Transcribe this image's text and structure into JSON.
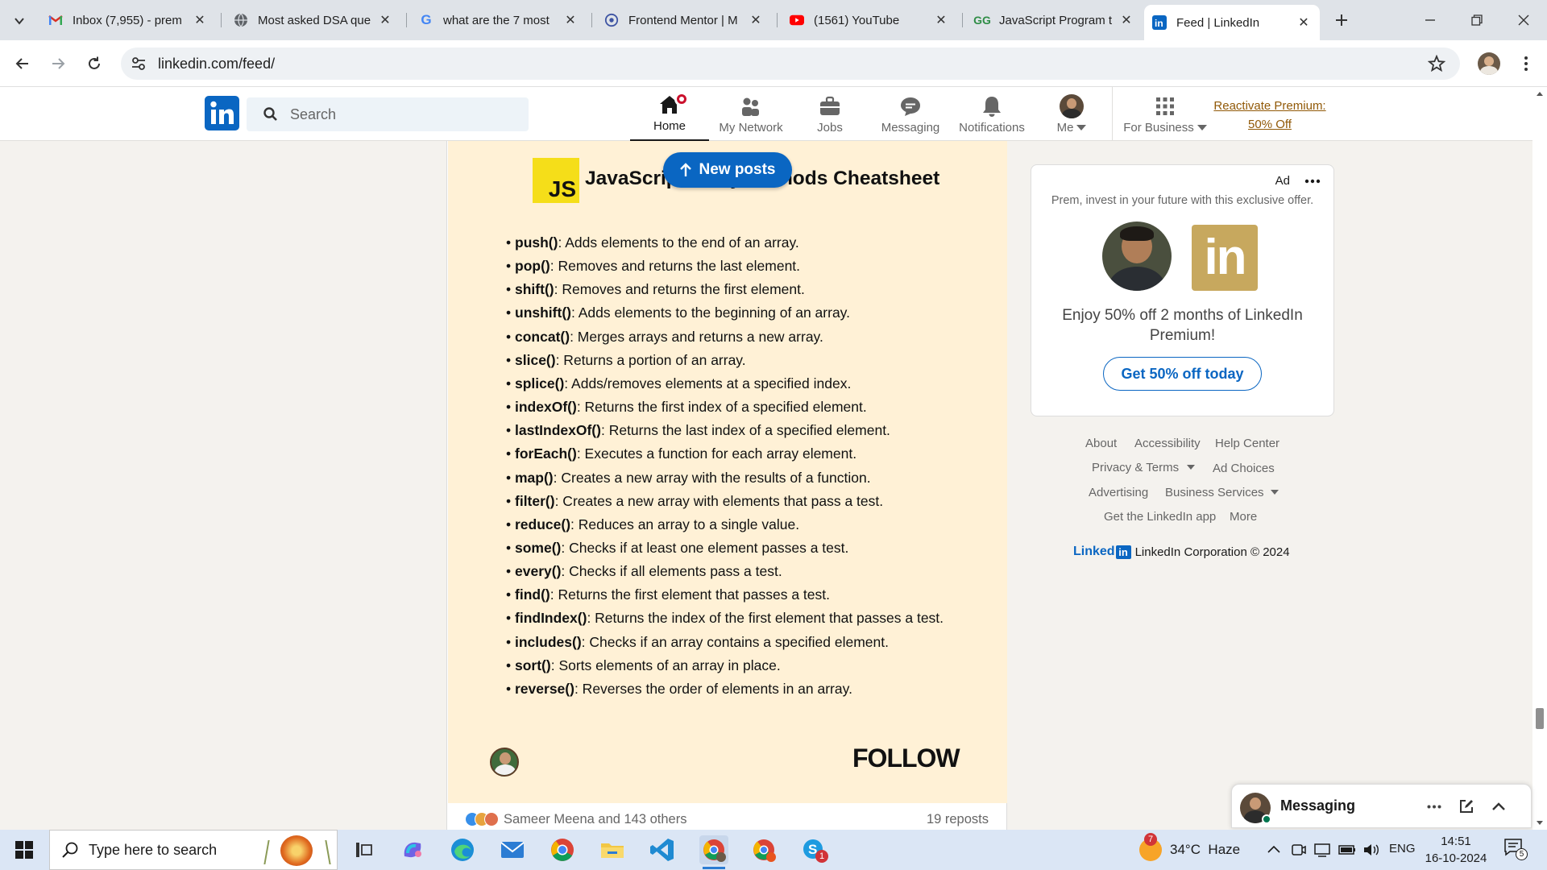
{
  "browser": {
    "tabs": [
      {
        "title": "Inbox (7,955) - prem"
      },
      {
        "title": "Most asked DSA que"
      },
      {
        "title": "what are the 7 most"
      },
      {
        "title": "Frontend Mentor | M"
      },
      {
        "title": "(1561) YouTube"
      },
      {
        "title": "JavaScript Program t"
      },
      {
        "title": "Feed | LinkedIn"
      }
    ],
    "url": "linkedin.com/feed/"
  },
  "linkedin": {
    "search_placeholder": "Search",
    "nav": {
      "home": "Home",
      "network": "My Network",
      "jobs": "Jobs",
      "messaging": "Messaging",
      "notifications": "Notifications",
      "me": "Me",
      "business": "For Business",
      "premium_line1": "Reactivate Premium:",
      "premium_line2": "50% Off"
    },
    "home_badge_color": "#cb112d"
  },
  "post": {
    "new_posts": "New posts",
    "sheet_badge": "JS",
    "sheet_title": "JavaScript Array Methods Cheatsheet",
    "methods": [
      {
        "name": "push()",
        "desc": ": Adds elements to the end of an array."
      },
      {
        "name": "pop()",
        "desc": ": Removes and returns the last element."
      },
      {
        "name": "shift()",
        "desc": ": Removes and returns the first element."
      },
      {
        "name": "unshift()",
        "desc": ": Adds elements to the beginning of an array."
      },
      {
        "name": "concat()",
        "desc": ": Merges arrays and returns a new array."
      },
      {
        "name": "slice()",
        "desc": ": Returns a portion of an array."
      },
      {
        "name": "splice()",
        "desc": ": Adds/removes elements at a specified index."
      },
      {
        "name": "indexOf()",
        "desc": ": Returns the first index of a specified element."
      },
      {
        "name": "lastIndexOf()",
        "desc": ": Returns the last index of a specified element."
      },
      {
        "name": "forEach()",
        "desc": ": Executes a function for each array element."
      },
      {
        "name": "map()",
        "desc": ": Creates a new array with the results of a function."
      },
      {
        "name": "filter()",
        "desc": ": Creates a new array with elements that pass a test."
      },
      {
        "name": "reduce()",
        "desc": ": Reduces an array to a single value."
      },
      {
        "name": "some()",
        "desc": ": Checks if at least one element passes a test."
      },
      {
        "name": "every()",
        "desc": ": Checks if all elements pass a test."
      },
      {
        "name": "find()",
        "desc": ": Returns the first element that passes a test."
      },
      {
        "name": "findIndex()",
        "desc": ": Returns the index of the first element that passes a test."
      },
      {
        "name": "includes()",
        "desc": ": Checks if an array contains a specified element."
      },
      {
        "name": "sort()",
        "desc": ": Sorts elements of an array in place."
      },
      {
        "name": "reverse()",
        "desc": ": Reverses the order of elements in an array."
      }
    ],
    "follow": "FOLLOW",
    "reactions": "Sameer Meena and 143 others",
    "reposts": "19 reposts"
  },
  "ad": {
    "label": "Ad",
    "tagline": "Prem, invest in your future with this exclusive offer.",
    "offer": "Enjoy 50% off 2 months of LinkedIn Premium!",
    "cta": "Get 50% off today"
  },
  "footer": {
    "about": "About",
    "accessibility": "Accessibility",
    "help": "Help Center",
    "privacy": "Privacy & Terms",
    "adchoices": "Ad Choices",
    "advertising": "Advertising",
    "business": "Business Services",
    "app": "Get the LinkedIn app",
    "more": "More",
    "brand": "Linked",
    "copyright": "LinkedIn Corporation © 2024"
  },
  "messaging": {
    "label": "Messaging"
  },
  "taskbar": {
    "search_placeholder": "Type here to search",
    "weather_alert": "7",
    "weather": "34°C  Haze",
    "lang": "ENG",
    "time": "14:51",
    "date": "16-10-2024",
    "notif_count": "5",
    "app_badge": "1"
  }
}
